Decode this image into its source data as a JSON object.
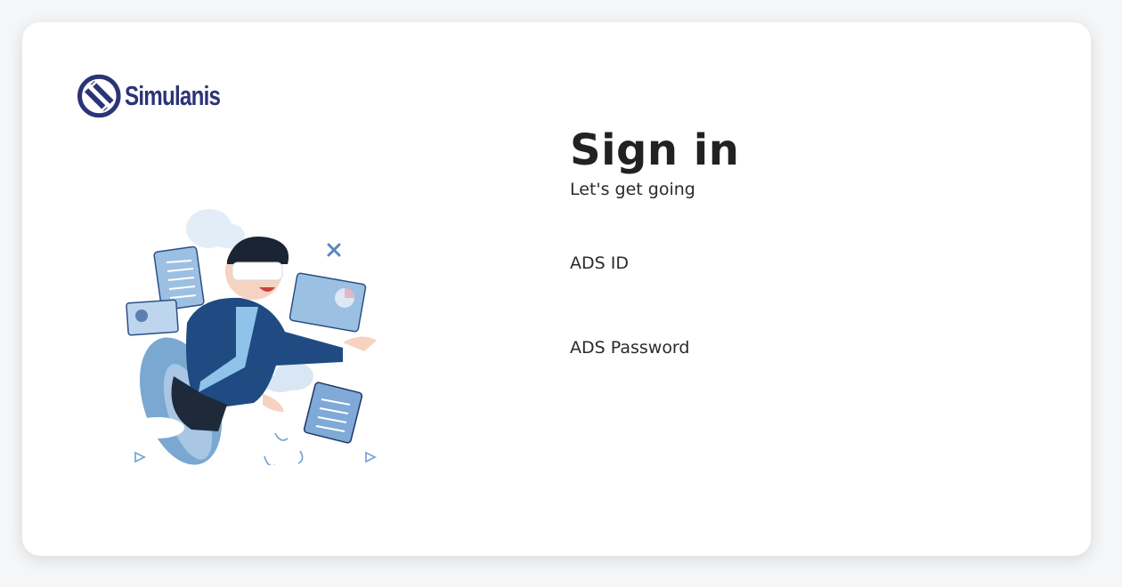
{
  "brand": {
    "name": "Simulanis",
    "primary_color": "#2c3478",
    "accent_color": "#d12b3a"
  },
  "illustration": {
    "icon": "person-with-vr-headset-illustration"
  },
  "form": {
    "title": "Sign in",
    "subtitle": "Let's get going",
    "ads_id_label": "ADS ID",
    "ads_id_value": "",
    "password_label": "ADS Password",
    "password_value": ""
  }
}
